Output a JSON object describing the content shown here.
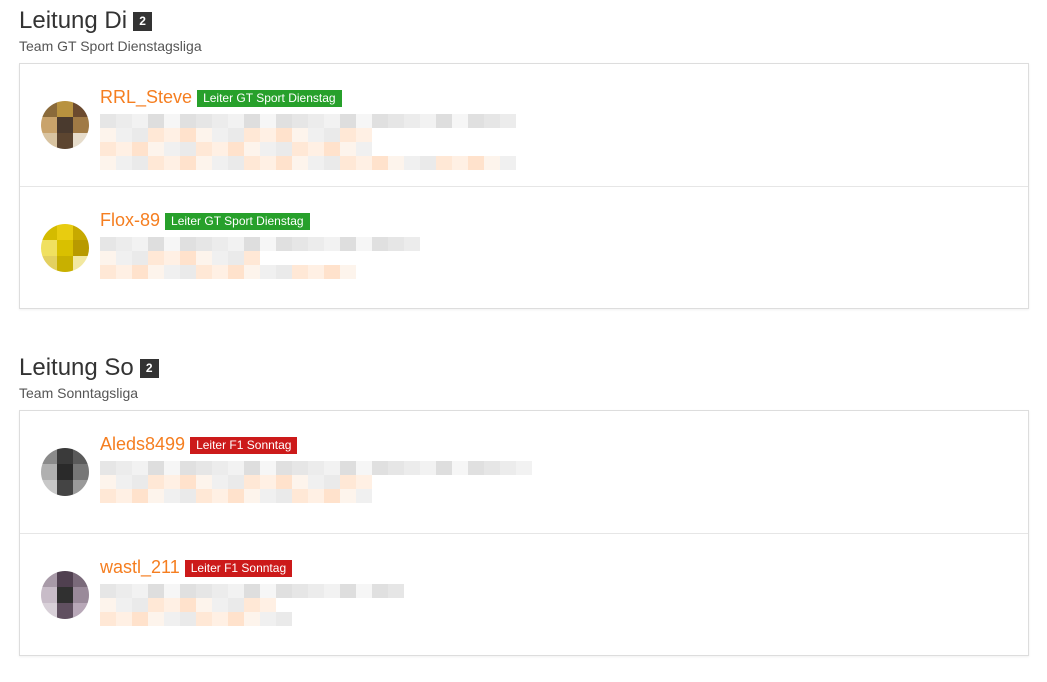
{
  "sections": [
    {
      "title": "Leitung Di",
      "count": "2",
      "subtitle": "Team GT Sport Dienstagsliga",
      "members": [
        {
          "name": "RRL_Steve",
          "rank": "Leiter GT Sport Dienstag",
          "rank_color": "#27a02b",
          "avatar": "avatar-steve"
        },
        {
          "name": "Flox-89",
          "rank": "Leiter GT Sport Dienstag",
          "rank_color": "#27a02b",
          "avatar": "avatar-flox"
        }
      ]
    },
    {
      "title": "Leitung So",
      "count": "2",
      "subtitle": "Team Sonntagsliga",
      "members": [
        {
          "name": "Aleds8499",
          "rank": "Leiter F1 Sonntag",
          "rank_color": "#cc1a1a",
          "avatar": "avatar-aleds"
        },
        {
          "name": "wastl_211",
          "rank": "Leiter F1 Sonntag",
          "rank_color": "#cc1a1a",
          "avatar": "avatar-wastl"
        }
      ]
    }
  ],
  "colors": {
    "username": "#f57e20",
    "rank_green": "#27a02b",
    "rank_red": "#cc1a1a"
  }
}
